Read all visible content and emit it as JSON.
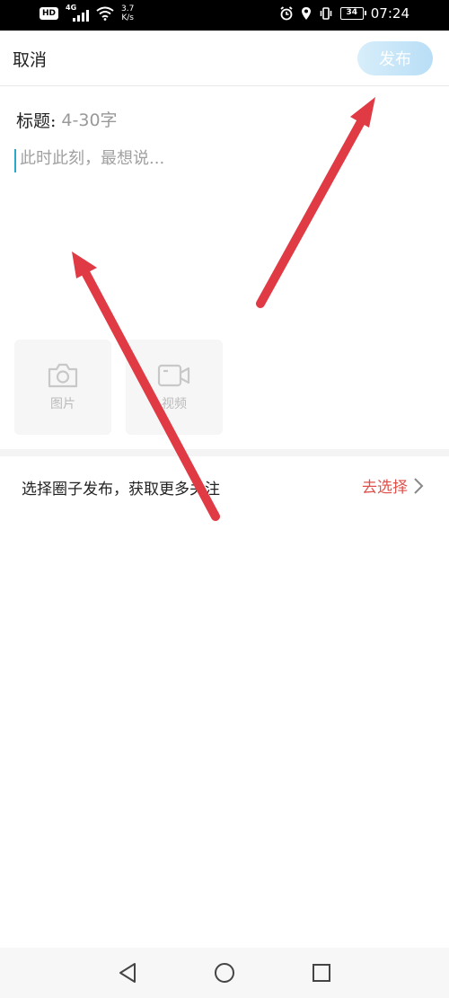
{
  "status_bar": {
    "hd": "HD",
    "network": "4G",
    "speed_value": "3.7",
    "speed_unit": "K/s",
    "battery": "34",
    "time": "07:24"
  },
  "header": {
    "cancel_label": "取消",
    "publish_label": "发布"
  },
  "compose": {
    "title_label": "标题:",
    "title_placeholder": "4-30字",
    "body_placeholder": "此时此刻，最想说..."
  },
  "media": {
    "photo_label": "图片",
    "video_label": "视频"
  },
  "circle": {
    "prompt": "选择圈子发布，获取更多关注",
    "action": "去选择"
  },
  "colors": {
    "accent_red": "#e0504a",
    "publish_bg": "#b8def6",
    "arrow_red": "#e03a45"
  }
}
